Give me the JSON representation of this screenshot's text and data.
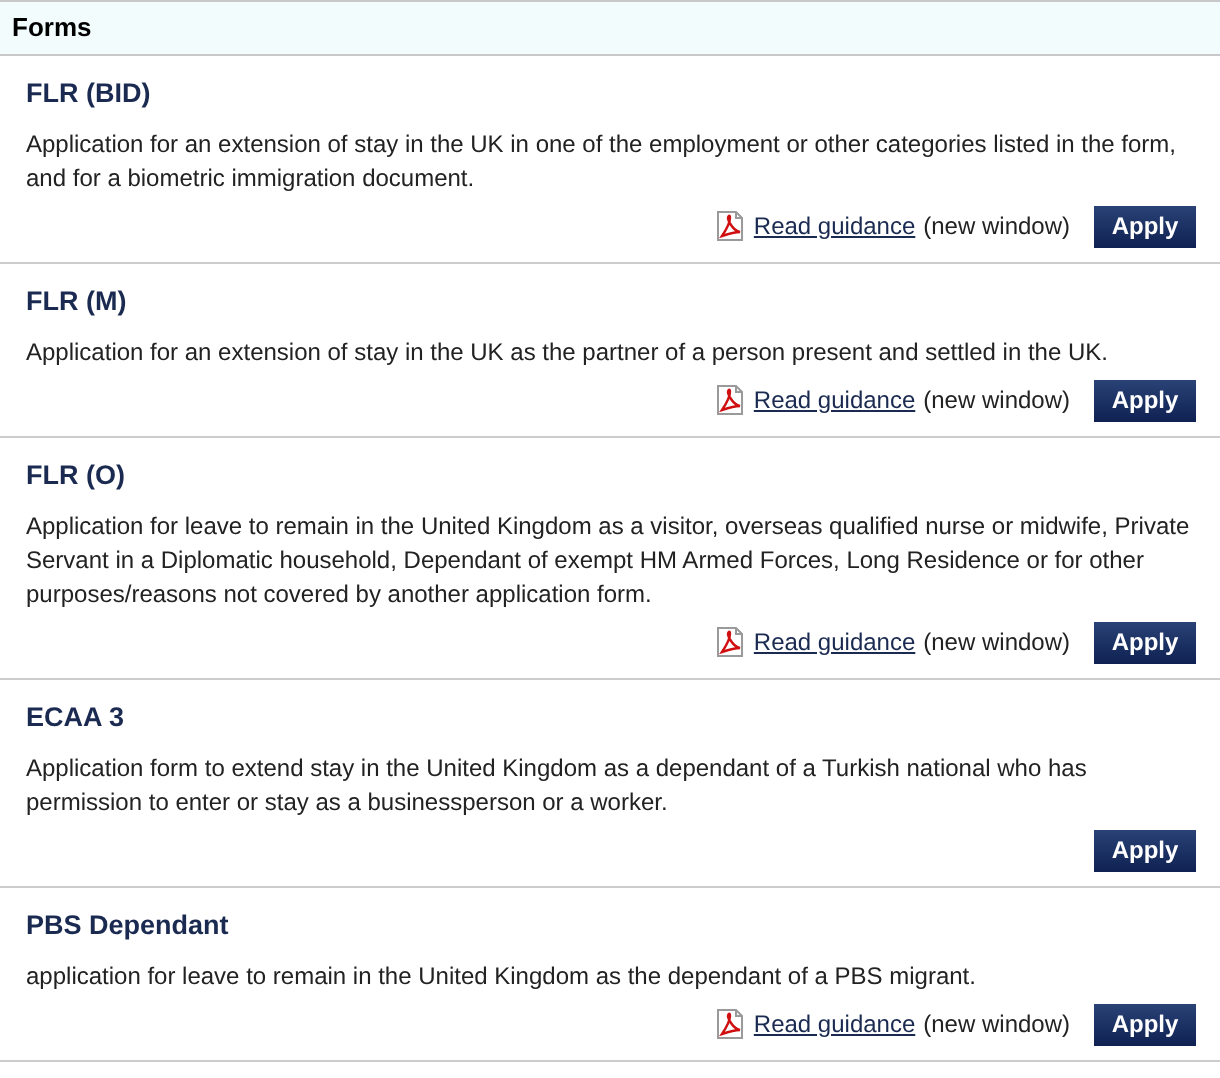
{
  "header": {
    "title": "Forms"
  },
  "forms": [
    {
      "title": "FLR (BID)",
      "description": "Application for an extension of stay in the UK in one of the employment or other categories listed in the form, and for a biometric immigration document.",
      "guidance": {
        "link": "Read guidance",
        "note": "(new window)"
      },
      "button": "Apply"
    },
    {
      "title": "FLR (M)",
      "description": "Application for an extension of stay in the UK as the partner of a person present and settled in the UK.",
      "guidance": {
        "link": "Read guidance",
        "note": "(new window)"
      },
      "button": "Apply"
    },
    {
      "title": "FLR (O)",
      "description": "Application for leave to remain in the United Kingdom as a visitor, overseas qualified nurse or midwife, Private Servant in a Diplomatic household, Dependant of exempt HM Armed Forces, Long Residence or for other purposes/reasons not covered by another application form.",
      "guidance": {
        "link": "Read guidance",
        "note": "(new window)"
      },
      "button": "Apply"
    },
    {
      "title": "ECAA 3",
      "description": "Application form to extend stay in the United Kingdom as a dependant of a Turkish national who has permission to enter or stay as a businessperson or a worker.",
      "button": "Apply"
    },
    {
      "title": "PBS Dependant",
      "description": "application for leave to remain in the United Kingdom as the dependant of a PBS migrant.",
      "guidance": {
        "link": "Read guidance",
        "note": "(new window)"
      },
      "button": "Apply"
    }
  ]
}
